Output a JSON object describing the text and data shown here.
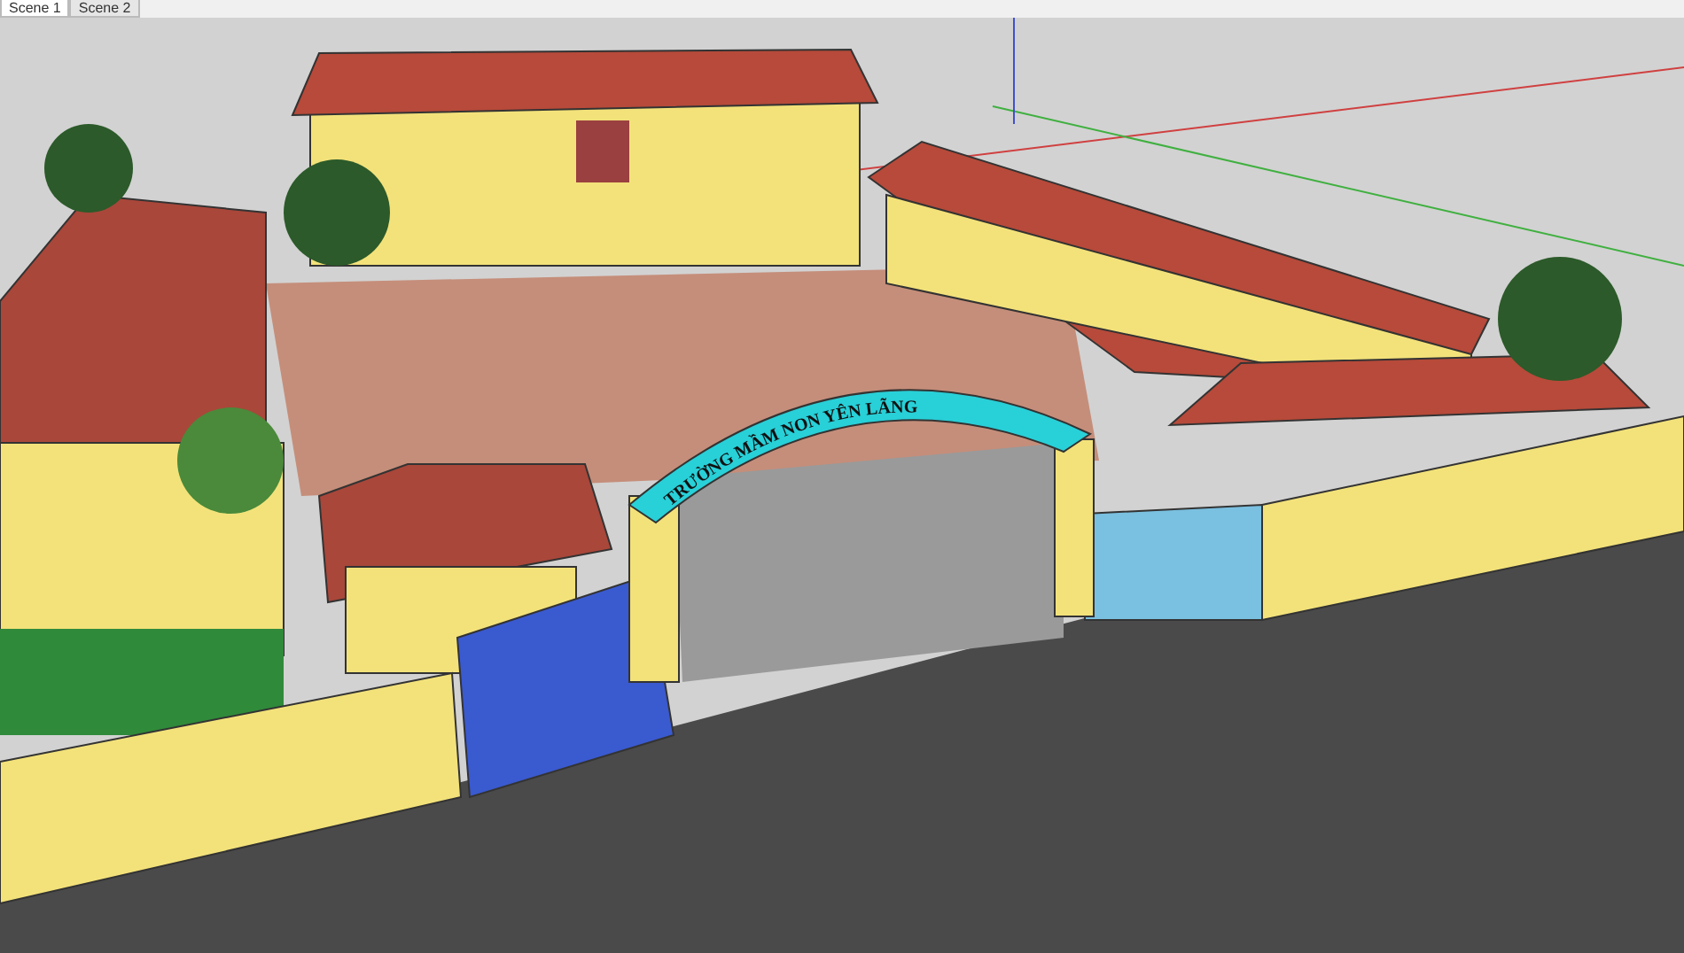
{
  "scene_tabs": [
    {
      "label": "Scene 1",
      "selected": true
    },
    {
      "label": "Scene 2",
      "selected": false
    }
  ],
  "viewport": {
    "arch_sign": "TRƯỜNG MẦM NON YÊN LÃNG"
  }
}
